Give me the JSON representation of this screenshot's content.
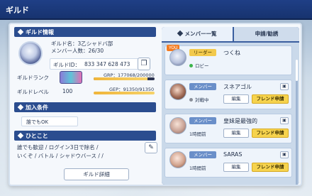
{
  "header": {
    "title": "ギルド"
  },
  "guild_info": {
    "section_title": "ギルド情報",
    "name_line": "ギルド名：3乙シャドバ部",
    "members_line": "メンバー人数：26/30",
    "id_label": "ギルドID：",
    "id_value": "833 347 628 473",
    "rank_label": "ギルドランク",
    "grp": "GRP：177068/200000",
    "grp_fraction": 0.885,
    "level_label": "ギルドレベル",
    "level_value": "100",
    "gep": "GEP：91350/91350",
    "gep_fraction": 1.0
  },
  "join_conditions": {
    "section_title": "加入条件",
    "value": "誰でもOK"
  },
  "comment": {
    "section_title": "ひとこと",
    "text_line1": "誰でも歓迎 / ログイン3日で除名 /",
    "text_line2": "いくぞ / バトル / シャドウバース / /"
  },
  "buttons": {
    "guild_detail": "ギルド詳細"
  },
  "tabs": {
    "member_list": "メンバー一覧",
    "applications": "申請/勧誘"
  },
  "members": [
    {
      "you": "YOU",
      "role": "リーダー",
      "name": "つくね",
      "status": "ロビー",
      "status_color": "#3cb44b"
    },
    {
      "role": "メンバー",
      "name": "スネアゴル",
      "status": "対戦中",
      "status_color": "#8a8f99",
      "edit": "編集",
      "friend": "フレンド申請"
    },
    {
      "role": "メンバー",
      "name": "皇妹是最強的",
      "status": "1時間前",
      "edit": "編集",
      "friend": "フレンド申請"
    },
    {
      "role": "メンバー",
      "name": "SARAS",
      "status": "1時間前",
      "edit": "編集",
      "friend": "フレンド申請"
    }
  ]
}
